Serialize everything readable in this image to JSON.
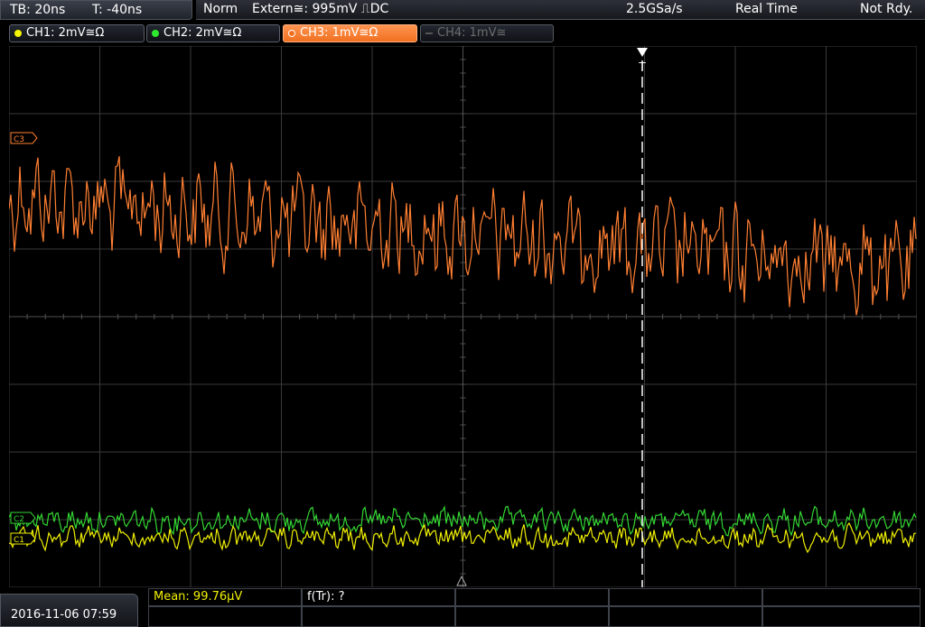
{
  "timebase": {
    "tb": "TB: 20ns",
    "trigger_time": "T: -40ns"
  },
  "acquisition": {
    "mode": "Norm",
    "trigger": "Extern≅: 995mV ⎍DC",
    "sample_rate": "2.5GSa/s",
    "display_mode": "Real Time",
    "status": "Not Rdy."
  },
  "channels": [
    {
      "label": "CH1: 2mV≅Ω",
      "color": "#f5f500",
      "active": true
    },
    {
      "label": "CH2: 2mV≅Ω",
      "color": "#2ee82e",
      "active": true
    },
    {
      "label": "CH3: 1mV≅Ω",
      "color": "#ff8a3d",
      "active": true,
      "selected": true
    },
    {
      "label": "CH4: 1mV≅",
      "color": "#6c6c6c",
      "active": false
    }
  ],
  "markers": {
    "ch3": "C3",
    "ch1": "C1",
    "ch2": "C2",
    "trigger": "T"
  },
  "colors": {
    "grid": "#3a3a3a",
    "ch3": "#ff7f32",
    "ch1": "#f0f000",
    "ch2": "#33d633",
    "background": "#000000"
  },
  "datetime": "2016-11-06 07:59",
  "measurements": {
    "mean": "Mean: 99.76µV",
    "frequency": "f(Tr): ?"
  }
}
